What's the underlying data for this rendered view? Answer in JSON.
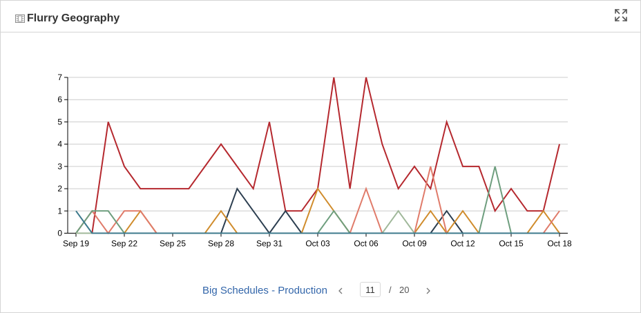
{
  "panel": {
    "title": "Flurry Geography",
    "title_icon": "film-icon",
    "expand_icon": "expand-icon"
  },
  "pager": {
    "label": "Big Schedules - Production",
    "current_page": "11",
    "separator": "/",
    "total_pages": "20",
    "prev_icon": "chevron-left-icon",
    "next_icon": "chevron-right-icon"
  },
  "chart_data": {
    "type": "line",
    "title": "",
    "xlabel": "",
    "ylabel": "",
    "ylim": [
      0,
      7
    ],
    "yticks": [
      "0",
      "1",
      "2",
      "3",
      "4",
      "5",
      "6",
      "7"
    ],
    "grid": true,
    "legend": "none",
    "x": [
      "Sep 19",
      "Sep 20",
      "Sep 21",
      "Sep 22",
      "Sep 23",
      "Sep 24",
      "Sep 25",
      "Sep 26",
      "Sep 27",
      "Sep 28",
      "Sep 29",
      "Sep 30",
      "Sep 31",
      "Oct 01",
      "Oct 02",
      "Oct 03",
      "Oct 04",
      "Oct 05",
      "Oct 06",
      "Oct 07",
      "Oct 08",
      "Oct 09",
      "Oct 10",
      "Oct 11",
      "Oct 12",
      "Oct 13",
      "Oct 14",
      "Oct 15",
      "Oct 16",
      "Oct 17",
      "Oct 18"
    ],
    "xtick_labels": [
      "Sep 19",
      "Sep 22",
      "Sep 25",
      "Sep 28",
      "Sep 31",
      "Oct 03",
      "Oct 06",
      "Oct 09",
      "Oct 12",
      "Oct 15",
      "Oct 18"
    ],
    "series": [
      {
        "color": "#b5282e",
        "values": [
          0,
          0,
          5,
          3,
          2,
          2,
          2,
          2,
          3,
          4,
          3,
          2,
          5,
          1,
          1,
          2,
          7,
          2,
          7,
          4,
          2,
          3,
          2,
          5,
          3,
          3,
          1,
          2,
          1,
          1,
          4
        ]
      },
      {
        "color": "#2c3e50",
        "values": [
          0,
          0,
          0,
          0,
          0,
          0,
          0,
          0,
          0,
          0,
          2,
          1,
          0,
          1,
          0,
          0,
          0,
          0,
          0,
          0,
          0,
          0,
          0,
          1,
          0,
          0,
          0,
          0,
          0,
          0,
          0
        ]
      },
      {
        "color": "#d08c2c",
        "values": [
          0,
          0,
          0,
          0,
          1,
          0,
          0,
          0,
          0,
          1,
          0,
          0,
          0,
          0,
          0,
          2,
          1,
          0,
          0,
          0,
          0,
          0,
          1,
          0,
          1,
          0,
          0,
          0,
          0,
          1,
          0
        ]
      },
      {
        "color": "#e07b6a",
        "values": [
          0,
          1,
          0,
          1,
          1,
          0,
          0,
          0,
          0,
          0,
          0,
          0,
          0,
          0,
          0,
          0,
          0,
          0,
          2,
          0,
          0,
          0,
          3,
          0,
          0,
          0,
          0,
          0,
          0,
          0,
          1
        ]
      },
      {
        "color": "#6e9e7e",
        "values": [
          0,
          1,
          1,
          0,
          0,
          0,
          0,
          0,
          0,
          0,
          0,
          0,
          0,
          0,
          0,
          0,
          1,
          0,
          0,
          0,
          0,
          0,
          0,
          0,
          0,
          0,
          3,
          0,
          0,
          0,
          0
        ]
      },
      {
        "color": "#a0b89a",
        "values": [
          0,
          0,
          0,
          0,
          0,
          0,
          0,
          0,
          0,
          0,
          0,
          0,
          0,
          0,
          0,
          0,
          0,
          0,
          0,
          0,
          1,
          0,
          0,
          0,
          0,
          0,
          0,
          0,
          0,
          0,
          0
        ]
      },
      {
        "color": "#3d7a8c",
        "values": [
          1,
          0,
          0,
          0,
          0,
          0,
          0,
          0,
          0,
          0,
          0,
          0,
          0,
          0,
          0,
          0,
          0,
          0,
          0,
          0,
          0,
          0,
          0,
          0,
          0,
          0,
          0,
          0,
          0,
          0,
          0
        ]
      }
    ]
  }
}
